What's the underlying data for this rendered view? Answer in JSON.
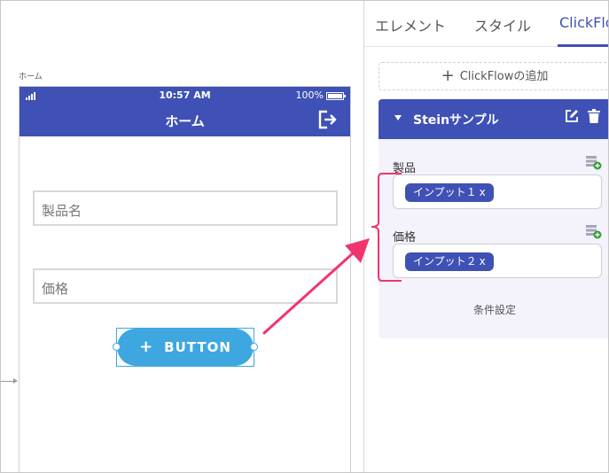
{
  "canvas": {
    "screen_label": "ホーム"
  },
  "phone": {
    "status": {
      "time": "10:57 AM",
      "battery": "100%"
    },
    "app_bar": {
      "title": "ホーム"
    },
    "fields": [
      {
        "placeholder": "製品名"
      },
      {
        "placeholder": "価格"
      }
    ],
    "button": {
      "icon": "+",
      "label": "BUTTON"
    }
  },
  "panel": {
    "tabs": [
      {
        "label": "エレメント"
      },
      {
        "label": "スタイル"
      },
      {
        "label": "ClickFlow"
      }
    ],
    "add_clickflow": {
      "icon": "+",
      "label": "ClickFlowの追加"
    },
    "flow": {
      "title": "Steinサンプル",
      "params": [
        {
          "label": "製品",
          "chip": "インプット１",
          "chip_close": "x"
        },
        {
          "label": "価格",
          "chip": "インプット２",
          "chip_close": "x"
        }
      ],
      "condition_label": "条件設定"
    }
  },
  "colors": {
    "brand": "#3f51b5",
    "button": "#3ea7e0",
    "annotation": "#f0356e",
    "card_background": "#f4f2fb"
  },
  "icons": [
    "signal-icon",
    "battery-icon",
    "logout-icon",
    "plus-icon",
    "collapse-icon",
    "edit-icon",
    "delete-icon",
    "add-field-icon"
  ]
}
